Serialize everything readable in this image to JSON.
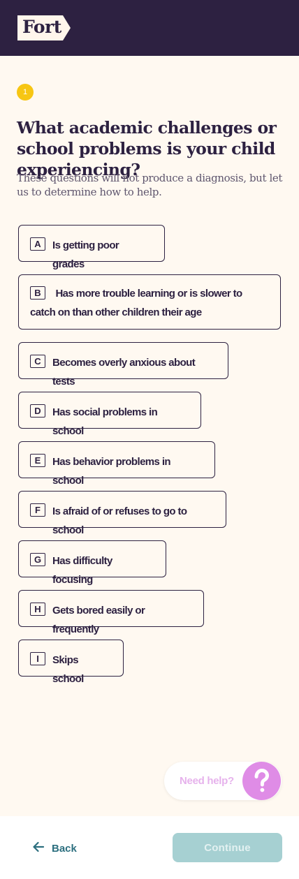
{
  "header": {
    "logo_text": "Fort"
  },
  "step": {
    "number": "1"
  },
  "question": {
    "title": "What academic challenges or school problems is your child experiencing?",
    "subtitle": "These questions will not produce a diagnosis, but let us to determine how to help."
  },
  "options": [
    {
      "key": "A",
      "label": "Is getting poor grades"
    },
    {
      "key": "B",
      "label": "Has more trouble learning or is slower to catch on than other children their age"
    },
    {
      "key": "C",
      "label": "Becomes overly anxious about tests"
    },
    {
      "key": "D",
      "label": "Has social problems in school"
    },
    {
      "key": "E",
      "label": "Has behavior problems in school"
    },
    {
      "key": "F",
      "label": "Is afraid of or refuses to go to school"
    },
    {
      "key": "G",
      "label": "Has difficulty focusing"
    },
    {
      "key": "H",
      "label": "Gets bored easily or frequently"
    },
    {
      "key": "I",
      "label": "Skips school"
    }
  ],
  "help": {
    "label": "Need help?"
  },
  "footer": {
    "back_label": "Back",
    "continue_label": "Continue"
  },
  "colors": {
    "header_bg": "#2d2141",
    "page_bg": "#fff9f1",
    "step_badge": "#f7c613",
    "accent_teal": "#2c6f7f",
    "continue_disabled": "#a6d0d2",
    "help_pink": "#df8ce6"
  },
  "icons": {
    "back": "arrow-left-icon",
    "help": "question-mark-icon"
  }
}
